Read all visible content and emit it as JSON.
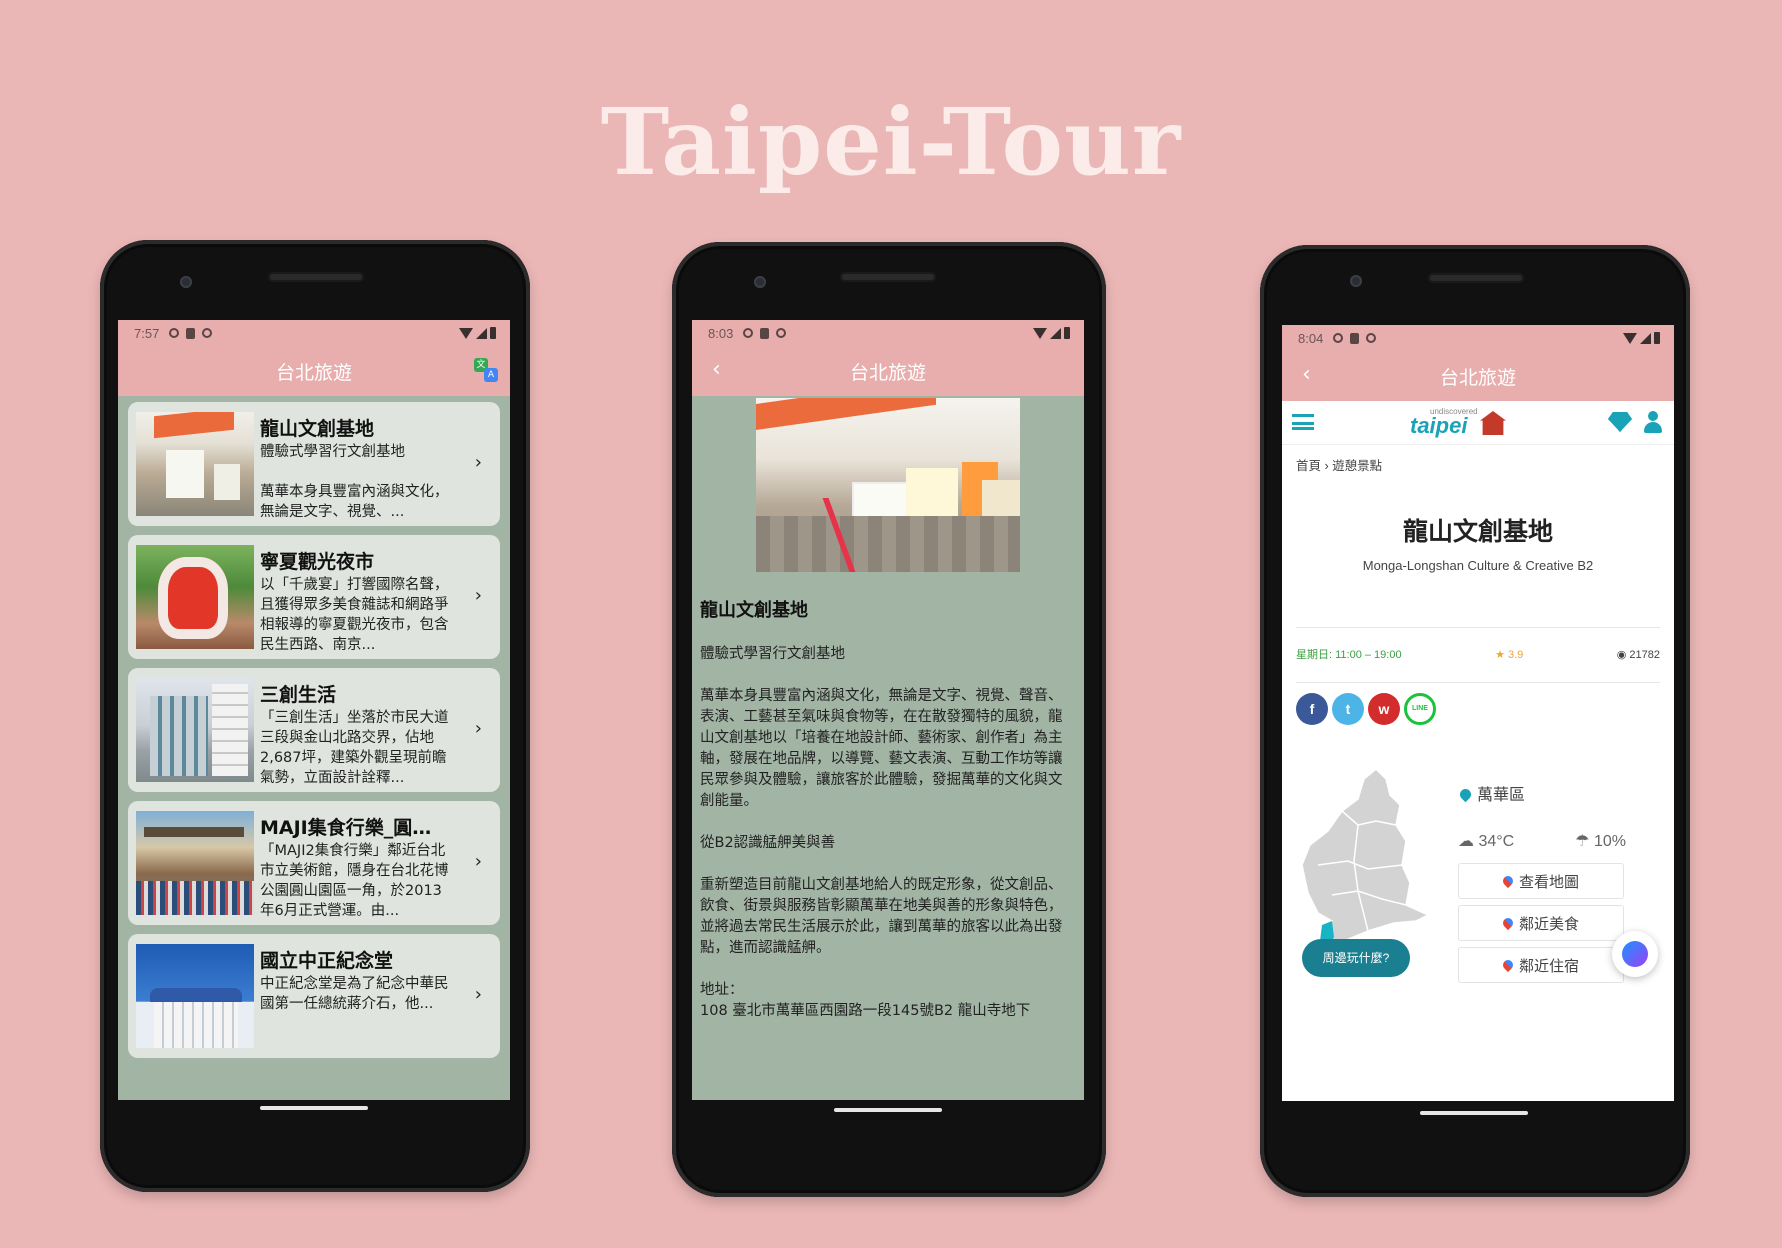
{
  "page_title": "Taipei-Tour",
  "phone1": {
    "status_time": "7:57",
    "appbar_title": "台北旅遊",
    "items": [
      {
        "title": "龍山文創基地",
        "desc": "體驗式學習行文創基地\n\n萬華本身具豐富內涵與文化，無論是文字、視覺、..."
      },
      {
        "title": "寧夏觀光夜市",
        "desc": "以「千歲宴」打響國際名聲，且獲得眾多美食雜誌和網路爭相報導的寧夏觀光夜市，包含民生西路、南京..."
      },
      {
        "title": "三創生活",
        "desc": "「三創生活」坐落於市民大道三段與金山北路交界，佔地2,687坪，建築外觀呈現前瞻氣勢，立面設計詮釋..."
      },
      {
        "title": "MAJI集食行樂_圓山...",
        "desc": "「MAJI2集食行樂」鄰近台北市立美術館，隱身在台北花博公園圓山園區一角，於2013年6月正式營運。由..."
      },
      {
        "title": "國立中正紀念堂",
        "desc": "中正紀念堂是為了紀念中華民國第一任總統蔣介石，他..."
      }
    ]
  },
  "phone2": {
    "status_time": "8:03",
    "appbar_title": "台北旅遊",
    "back_label": "‹",
    "title": "龍山文創基地",
    "body": "體驗式學習行文創基地\n\n萬華本身具豐富內涵與文化，無論是文字、視覺、聲音、表演、工藝甚至氣味與食物等，在在散發獨特的風貌，龍山文創基地以「培養在地設計師、藝術家、創作者」為主軸，發展在地品牌，以導覽、藝文表演、互動工作坊等讓民眾參與及體驗，讓旅客於此體驗，發掘萬華的文化與文創能量。\n\n從B2認識艋舺美與善\n\n重新塑造目前龍山文創基地給人的既定形象，從文創品、飲食、街景與服務皆彰顯萬華在地美與善的形象與特色，並將過去常民生活展示於此，讓到萬華的旅客以此為出發點，進而認識艋舺。\n\n地址：\n108 臺北市萬華區西園路一段145號B2 龍山寺地下"
  },
  "phone3": {
    "status_time": "8:04",
    "appbar_title": "台北旅遊",
    "back_label": "‹",
    "logo_small": "undiscovered",
    "logo_big": "taipei",
    "breadcrumb": "首頁 ›  遊憩景點",
    "place_title": "龍山文創基地",
    "place_subtitle": "Monga-Longshan Culture & Creative B2",
    "hours": "星期日: 11:00 – 19:00",
    "rating": "★ 3.9",
    "views": "◉ 21782",
    "district": "萬華區",
    "temperature": "34°C",
    "rain": "10%",
    "buttons": [
      "查看地圖",
      "鄰近美食",
      "鄰近住宿"
    ],
    "around_button": "周邊玩什麼?",
    "social": [
      "f",
      "t",
      "w",
      "LINE"
    ]
  },
  "colors": {
    "background": "#ebb7b6",
    "appbar": "#e8adad",
    "list_bg": "#a2b5a5",
    "card": "#dfe5de",
    "teal": "#1aa3b7"
  }
}
